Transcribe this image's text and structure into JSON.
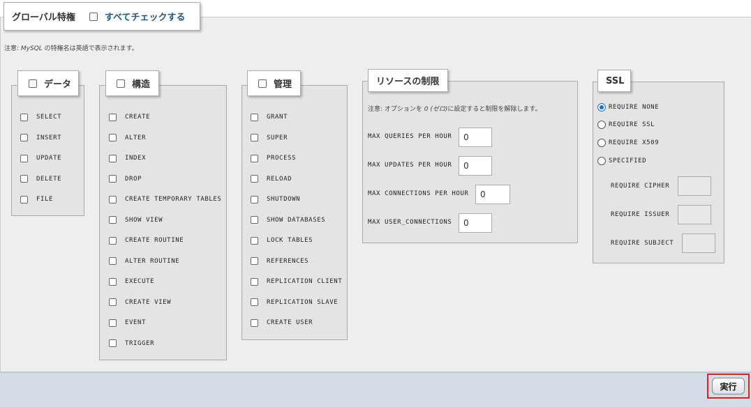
{
  "header": {
    "title": "グローバル特権",
    "check_all_label": "すべてチェックする"
  },
  "note": {
    "prefix": "注意: ",
    "mysql": "MySQL",
    "suffix": " の特権名は英語で表示されます。"
  },
  "data_group": {
    "title": "データ",
    "items": [
      "SELECT",
      "INSERT",
      "UPDATE",
      "DELETE",
      "FILE"
    ]
  },
  "structure_group": {
    "title": "構造",
    "items": [
      "CREATE",
      "ALTER",
      "INDEX",
      "DROP",
      "CREATE TEMPORARY TABLES",
      "SHOW VIEW",
      "CREATE ROUTINE",
      "ALTER ROUTINE",
      "EXECUTE",
      "CREATE VIEW",
      "EVENT",
      "TRIGGER"
    ]
  },
  "admin_group": {
    "title": "管理",
    "items": [
      "GRANT",
      "SUPER",
      "PROCESS",
      "RELOAD",
      "SHUTDOWN",
      "SHOW DATABASES",
      "LOCK TABLES",
      "REFERENCES",
      "REPLICATION CLIENT",
      "REPLICATION SLAVE",
      "CREATE USER"
    ]
  },
  "resources": {
    "title": "リソースの制限",
    "note_prefix": "注意: オプションを ",
    "note_zero": "0 (ゼロ)",
    "note_suffix": "に設定すると制限を解除します。",
    "fields": [
      {
        "label": "MAX QUERIES PER HOUR",
        "value": "0"
      },
      {
        "label": "MAX UPDATES PER HOUR",
        "value": "0"
      },
      {
        "label": "MAX CONNECTIONS PER HOUR",
        "value": "0"
      },
      {
        "label": "MAX USER_CONNECTIONS",
        "value": "0"
      }
    ]
  },
  "ssl": {
    "title": "SSL",
    "options": [
      "REQUIRE NONE",
      "REQUIRE SSL",
      "REQUIRE X509",
      "SPECIFIED"
    ],
    "selected": "REQUIRE NONE",
    "fields": [
      "REQUIRE CIPHER",
      "REQUIRE ISSUER",
      "REQUIRE SUBJECT"
    ]
  },
  "footer": {
    "go_label": "実行"
  },
  "colors": {
    "accent": "#1a6fe0",
    "footer_bg": "#d4dde6",
    "highlight": "#e02020"
  }
}
